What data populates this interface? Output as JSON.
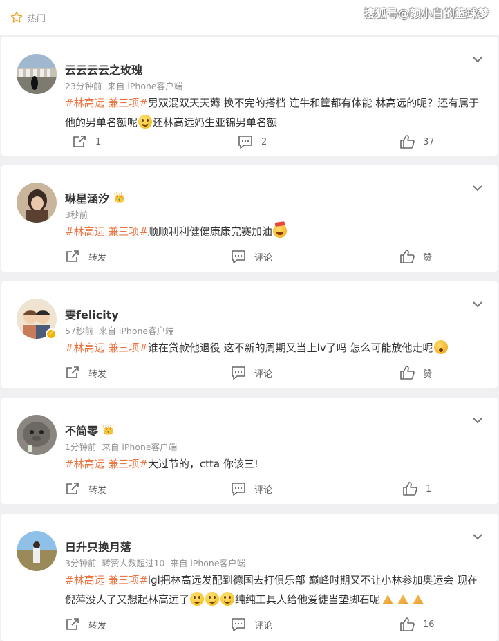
{
  "header": {
    "hot_label": "热门",
    "watermark": "搜狐号@颜小白的篮球梦"
  },
  "posts": [
    {
      "username": "云云云云之玫瑰",
      "meta": [
        "23分钟前",
        "来自 iPhone客户端"
      ],
      "tag": "#林高远 兼三项#",
      "text_a": "男双混双天天薅 换不完的搭档 连牛和筐都有体能 林高远的呢？还有属于他的男单名额呢",
      "text_b": "还林高远妈生亚锦男单名额",
      "emojis": [
        "smile"
      ],
      "repost": "1",
      "comment": "2",
      "like": "37"
    },
    {
      "username": "琳星涵汐",
      "meta": [
        "3秒前"
      ],
      "tag": "#林高远 兼三项#",
      "text_a": "顺顺利利健健康康完赛加油",
      "text_b": "",
      "emojis": [
        "party"
      ],
      "repost": "转发",
      "comment": "评论",
      "like": "赞"
    },
    {
      "username": "雯felicity",
      "meta": [
        "57秒前",
        "来自 iPhone客户端"
      ],
      "tag": "#林高远 兼三项#",
      "text_a": "谁在贷款他退役 这不新的周期又当上lv了吗 怎么可能放他走呢",
      "text_b": "",
      "emojis": [
        "sad"
      ],
      "repost": "转发",
      "comment": "评论",
      "like": "赞"
    },
    {
      "username": "不简零",
      "meta": [
        "1分钟前",
        "来自 iPhone客户端"
      ],
      "tag": "#林高远 兼三项#",
      "text_a": "大过节的，ctta 你该三!",
      "text_b": "",
      "emojis": [],
      "repost": "转发",
      "comment": "评论",
      "like": "1"
    },
    {
      "username": "日升只换月落",
      "meta": [
        "3分钟前",
        "转赞人数超过10",
        "来自 iPhone客户端"
      ],
      "tag": "#林高远 兼三项#",
      "text_a": "lgl把林高远发配到德国去打俱乐部 巅峰时期又不让小林参加奥运会 现在倪萍没人了又想起林高远了",
      "text_b": "纯纯工具人给他爱徒当垫脚石呢",
      "emojis": [
        "smile",
        "smile",
        "smile",
        "hands",
        "hands",
        "hands"
      ],
      "repost": "转发",
      "comment": "评论",
      "like": "16"
    }
  ],
  "colors": {
    "tag": "#eb7340",
    "meta": "#939393",
    "background": "#f0f0f2"
  }
}
